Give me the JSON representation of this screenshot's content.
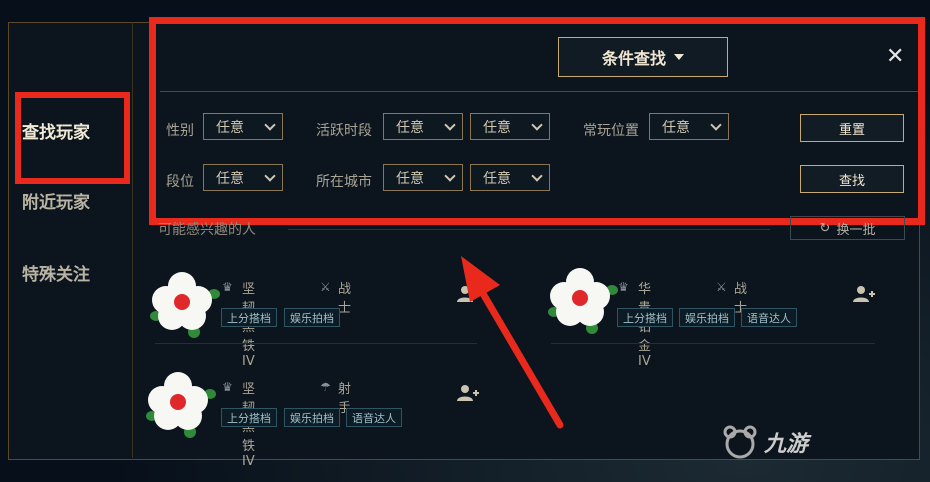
{
  "header": {
    "filter_mode_label": "条件查找",
    "close_glyph": "✕"
  },
  "sidebar": {
    "items": [
      {
        "label": "查找玩家"
      },
      {
        "label": "附近玩家"
      },
      {
        "label": "特殊关注"
      }
    ]
  },
  "filters": {
    "gender": {
      "label": "性别",
      "value": "任意"
    },
    "active_time": {
      "label": "活跃时段",
      "values": [
        "任意",
        "任意"
      ]
    },
    "position": {
      "label": "常玩位置",
      "value": "任意"
    },
    "rank": {
      "label": "段位",
      "value": "任意"
    },
    "city": {
      "label": "所在城市",
      "values": [
        "任意",
        "任意"
      ]
    },
    "reset_label": "重置",
    "search_label": "查找"
  },
  "suggestions": {
    "title": "可能感兴趣的人",
    "refresh_label": "换一批",
    "cards": [
      {
        "rank": "坚韧黑铁IV",
        "role": "战士",
        "tags": [
          "上分搭档",
          "娱乐拍档"
        ]
      },
      {
        "rank": "华贵铂金IV",
        "role": "战士",
        "tags": [
          "上分搭档",
          "娱乐拍档",
          "语音达人"
        ]
      },
      {
        "rank": "坚韧黑铁IV",
        "role": "射手",
        "tags": [
          "上分搭档",
          "娱乐拍档",
          "语音达人"
        ]
      }
    ]
  },
  "watermark": {
    "text": "九游"
  },
  "colors": {
    "highlight": "#e8291c",
    "gold": "#c8aa6e",
    "tag_border": "#2f5565"
  }
}
